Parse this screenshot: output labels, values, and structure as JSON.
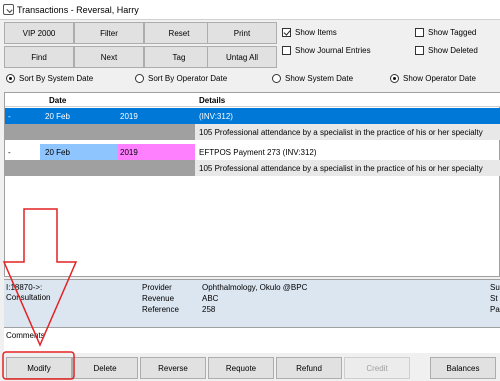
{
  "window": {
    "title": "Transactions - Reversal, Harry"
  },
  "toolbar": {
    "buttons_row1": [
      "VIP 2000",
      "Filter",
      "Reset",
      "Print"
    ],
    "buttons_row2": [
      "Find",
      "Next",
      "Tag",
      "Untag All"
    ],
    "show_items": {
      "label": "Show Items",
      "checked": true
    },
    "show_journal_entries": {
      "label": "Show Journal Entries",
      "checked": false
    },
    "show_tagged": {
      "label": "Show Tagged",
      "checked": false
    },
    "show_deleted": {
      "label": "Show Deleted",
      "checked": false
    }
  },
  "sort": {
    "options": [
      "Sort By System Date",
      "Sort By Operator Date",
      "Show System Date",
      "Show Operator Date"
    ],
    "selected": [
      "Sort By System Date",
      "Show Operator Date"
    ]
  },
  "grid": {
    "headers": {
      "date": "Date",
      "details": "Details"
    },
    "rows": [
      {
        "marker": "-",
        "date": "20 Feb",
        "year": "2019",
        "details": "(INV:312)",
        "description": "105 Professional attendance by a specialist in the practice of his or her specialty",
        "selected": true
      },
      {
        "marker": "-",
        "date": "20 Feb",
        "year": "2019",
        "details": "EFTPOS Payment  273  (INV:312)",
        "description": "105 Professional attendance by a specialist in the practice of his or her specialty",
        "selected": false
      }
    ]
  },
  "info": {
    "id": "I:18870->:",
    "type": "Consultation",
    "provider_label": "Provider",
    "provider_value": "Ophthalmology, Okulo @BPC",
    "revenue_label": "Revenue",
    "revenue_value": "ABC",
    "reference_label": "Reference",
    "reference_value": "258",
    "right_col": [
      "Su",
      "St",
      "Pa"
    ]
  },
  "comments": {
    "label": "Comments"
  },
  "bottom_buttons": [
    "Modify",
    "Delete",
    "Reverse",
    "Requote",
    "Refund",
    "Credit",
    "Balances"
  ],
  "annotation_color": "#e32222"
}
